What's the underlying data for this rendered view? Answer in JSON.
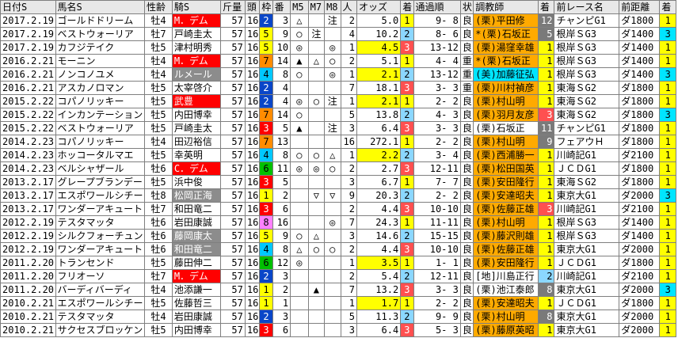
{
  "headers": [
    "日付S",
    "馬名S",
    "性齢",
    "騎S",
    "斤量",
    "頭",
    "枠",
    "番",
    "M5",
    "M7",
    "M8",
    "人",
    "オッズ",
    "着",
    "通過順",
    "状",
    "調教師",
    "着",
    "前レース名",
    "前距離",
    "着"
  ],
  "rows": [
    {
      "date": "2017.2.19",
      "horse": "ゴールドドリーム",
      "age": "牡4",
      "jockey": "M．デム",
      "jk": "red",
      "weight": "57",
      "heads": "16",
      "waku": "2",
      "uma": "3",
      "m5": "△",
      "m7": "",
      "m8": "注",
      "pop": "2",
      "odds": "5.0",
      "oddsHl": false,
      "fin": "1",
      "finC": "fin-1",
      "pass": "9- 8",
      "cond": "良",
      "trainer": "(栗)平田修",
      "trC": "tr-kansai",
      "pfin": "12",
      "pfinC": "fin-other",
      "prace": "チャンピG1",
      "praceC": "",
      "pdist": "ダ1800",
      "pf": "1",
      "pfC": "bar-yellow"
    },
    {
      "date": "2017.2.19",
      "horse": "ベストウォーリア",
      "age": "牡7",
      "jockey": "戸崎圭太",
      "jk": "yellow",
      "weight": "57",
      "heads": "16",
      "waku": "5",
      "uma": "9",
      "m5": "○",
      "m7": "注",
      "m8": "",
      "pop": "4",
      "odds": "10.2",
      "oddsHl": false,
      "fin": "2",
      "finC": "fin-2",
      "pass": "8- 6",
      "cond": "良",
      "trainer": "*(栗)石坂正",
      "trC": "tr-kansai",
      "pfin": "5",
      "pfinC": "fin-other",
      "prace": "根岸ＳG3",
      "praceC": "",
      "pdist": "ダ1400",
      "pf": "3",
      "pfC": "bar-cyan"
    },
    {
      "date": "2017.2.19",
      "horse": "カフジテイク",
      "age": "牡5",
      "jockey": "津村明秀",
      "jk": "yellow",
      "weight": "57",
      "heads": "16",
      "waku": "5",
      "uma": "10",
      "m5": "◎",
      "m7": "",
      "m8": "◎",
      "pop": "1",
      "odds": "4.5",
      "oddsHl": true,
      "fin": "3",
      "finC": "fin-3",
      "pass": "13-12",
      "cond": "良",
      "trainer": "(栗)湯窪幸雄",
      "trC": "tr-kansai",
      "pfin": "1",
      "pfinC": "fin-1",
      "prace": "根岸ＳG3",
      "praceC": "",
      "pdist": "ダ1400",
      "pf": "1",
      "pfC": "bar-yellow"
    },
    {
      "date": "2016.2.21",
      "horse": "モーニン",
      "age": "牡4",
      "jockey": "M．デム",
      "jk": "red",
      "weight": "57",
      "heads": "16",
      "waku": "7",
      "uma": "14",
      "m5": "▲",
      "m7": "△",
      "m8": "○",
      "pop": "2",
      "odds": "5.1",
      "oddsHl": false,
      "fin": "1",
      "finC": "fin-1",
      "pass": "4- 4",
      "cond": "重",
      "trainer": "*(栗)石坂正",
      "trC": "tr-kansai",
      "pfin": "1",
      "pfinC": "fin-1",
      "prace": "根岸ＳG3",
      "praceC": "",
      "pdist": "ダ1400",
      "pf": "1",
      "pfC": "bar-yellow"
    },
    {
      "date": "2016.2.21",
      "horse": "ノンコノユメ",
      "age": "牡4",
      "jockey": "ルメール",
      "jk": "gray",
      "weight": "57",
      "heads": "16",
      "waku": "4",
      "uma": "8",
      "m5": "○",
      "m7": "",
      "m8": "◎",
      "pop": "1",
      "odds": "2.1",
      "oddsHl": true,
      "fin": "2",
      "finC": "fin-2",
      "pass": "13-12",
      "cond": "重",
      "trainer": "(美)加藤征弘",
      "trC": "tr-kanto",
      "pfin": "1",
      "pfinC": "fin-1",
      "prace": "根岸ＳG3",
      "praceC": "",
      "pdist": "ダ1400",
      "pf": "3",
      "pfC": "bar-cyan"
    },
    {
      "date": "2016.2.21",
      "horse": "アスカノロマン",
      "age": "牡5",
      "jockey": "太宰啓介",
      "jk": "yellow",
      "weight": "57",
      "heads": "16",
      "waku": "2",
      "uma": "4",
      "m5": "",
      "m7": "",
      "m8": "",
      "pop": "7",
      "odds": "18.1",
      "oddsHl": false,
      "fin": "3",
      "finC": "fin-3",
      "pass": "3- 3",
      "cond": "重",
      "trainer": "(栗)川村禎彦",
      "trC": "tr-kansai",
      "pfin": "1",
      "pfinC": "fin-1",
      "prace": "東海ＳG2",
      "praceC": "",
      "pdist": "ダ1800",
      "pf": "1",
      "pfC": "bar-yellow"
    },
    {
      "date": "2015.2.22",
      "horse": "コパノリッキー",
      "age": "牡5",
      "jockey": "武豊",
      "jk": "red",
      "weight": "57",
      "heads": "16",
      "waku": "2",
      "uma": "4",
      "m5": "◎",
      "m7": "○",
      "m8": "注",
      "pop": "1",
      "odds": "2.1",
      "oddsHl": true,
      "fin": "1",
      "finC": "fin-1",
      "pass": "2- 2",
      "cond": "良",
      "trainer": "(栗)村山明",
      "trC": "tr-kansai",
      "pfin": "1",
      "pfinC": "fin-1",
      "prace": "東海ＳG2",
      "praceC": "",
      "pdist": "ダ1800",
      "pf": "1",
      "pfC": "bar-yellow"
    },
    {
      "date": "2015.2.22",
      "horse": "インカンテーション",
      "age": "牡5",
      "jockey": "内田博幸",
      "jk": "yellow",
      "weight": "57",
      "heads": "16",
      "waku": "7",
      "uma": "14",
      "m5": "○",
      "m7": "",
      "m8": "",
      "pop": "5",
      "odds": "13.8",
      "oddsHl": false,
      "fin": "2",
      "finC": "fin-2",
      "pass": "4- 3",
      "cond": "良",
      "trainer": "(栗)羽月友彦",
      "trC": "tr-kansai",
      "pfin": "3",
      "pfinC": "fin-3",
      "prace": "東海ＳG2",
      "praceC": "",
      "pdist": "ダ1800",
      "pf": "3",
      "pfC": "bar-cyan"
    },
    {
      "date": "2015.2.22",
      "horse": "ベストウォーリア",
      "age": "牡5",
      "jockey": "戸崎圭太",
      "jk": "yellow",
      "weight": "57",
      "heads": "16",
      "waku": "3",
      "uma": "5",
      "m5": "▲",
      "m7": "",
      "m8": "注",
      "pop": "3",
      "odds": "6.4",
      "oddsHl": false,
      "fin": "3",
      "finC": "fin-3",
      "pass": "3- 3",
      "cond": "良",
      "trainer": "(栗)石坂正",
      "trC": "tr-other",
      "pfin": "11",
      "pfinC": "fin-other",
      "prace": "チャンピG1",
      "praceC": "",
      "pdist": "ダ1800",
      "pf": "1",
      "pfC": "bar-yellow"
    },
    {
      "date": "2014.2.23",
      "horse": "コパノリッキー",
      "age": "牡4",
      "jockey": "田辺裕信",
      "jk": "yellow",
      "weight": "57",
      "heads": "16",
      "waku": "7",
      "uma": "13",
      "m5": "",
      "m7": "",
      "m8": "",
      "pop": "16",
      "odds": "272.1",
      "oddsHl": false,
      "fin": "1",
      "finC": "fin-1",
      "pass": "2- 2",
      "cond": "良",
      "trainer": "(栗)村山明",
      "trC": "tr-kansai",
      "pfin": "9",
      "pfinC": "fin-other",
      "prace": "フェアウＨ",
      "praceC": "",
      "pdist": "ダ1800",
      "pf": "1",
      "pfC": "bar-yellow"
    },
    {
      "date": "2014.2.23",
      "horse": "ホッコータルマエ",
      "age": "牡5",
      "jockey": "幸英明",
      "jk": "yellow",
      "weight": "57",
      "heads": "16",
      "waku": "4",
      "uma": "8",
      "m5": "○",
      "m7": "○",
      "m8": "△",
      "pop": "1",
      "odds": "2.2",
      "oddsHl": true,
      "fin": "2",
      "finC": "fin-2",
      "pass": "3- 4",
      "cond": "良",
      "trainer": "(栗)西浦勝一",
      "trC": "tr-kansai",
      "pfin": "1",
      "pfinC": "fin-1",
      "prace": "川崎記G1",
      "praceC": "",
      "pdist": "ダ2100",
      "pf": "1",
      "pfC": "bar-yellow"
    },
    {
      "date": "2014.2.23",
      "horse": "ベルシャザール",
      "age": "牡6",
      "jockey": "C．デム",
      "jk": "red",
      "weight": "57",
      "heads": "16",
      "waku": "6",
      "uma": "11",
      "m5": "◎",
      "m7": "◎",
      "m8": "○",
      "pop": "2",
      "odds": "2.7",
      "oddsHl": false,
      "fin": "3",
      "finC": "fin-3",
      "pass": "12-11",
      "cond": "良",
      "trainer": "(栗)松田国英",
      "trC": "tr-kansai",
      "pfin": "1",
      "pfinC": "fin-1",
      "prace": "ＪＣＤG1",
      "praceC": "",
      "pdist": "ダ1800",
      "pf": "1",
      "pfC": "bar-yellow"
    },
    {
      "date": "2013.2.17",
      "horse": "グレープブランデー",
      "age": "牡5",
      "jockey": "浜中俊",
      "jk": "yellow",
      "weight": "57",
      "heads": "16",
      "waku": "3",
      "uma": "5",
      "m5": "",
      "m7": "",
      "m8": "",
      "pop": "3",
      "odds": "6.7",
      "oddsHl": false,
      "fin": "1",
      "finC": "fin-1",
      "pass": "7- 7",
      "cond": "良",
      "trainer": "(栗)安田隆行",
      "trC": "tr-kansai",
      "pfin": "1",
      "pfinC": "fin-1",
      "prace": "東海ＳG2",
      "praceC": "",
      "pdist": "ダ1800",
      "pf": "1",
      "pfC": "bar-yellow"
    },
    {
      "date": "2013.2.17",
      "horse": "エスポワールシチー",
      "age": "牡8",
      "jockey": "松岡正海",
      "jk": "gray",
      "weight": "57",
      "heads": "16",
      "waku": "1",
      "uma": "2",
      "m5": "",
      "m7": "▽",
      "m8": "▽",
      "pop": "9",
      "odds": "20.3",
      "oddsHl": false,
      "fin": "2",
      "finC": "fin-2",
      "pass": "2- 2",
      "cond": "良",
      "trainer": "(栗)安達昭夫",
      "trC": "tr-kansai",
      "pfin": "1",
      "pfinC": "fin-1",
      "prace": "東京大G1",
      "praceC": "",
      "pdist": "ダ2000",
      "pf": "3",
      "pfC": "bar-cyan"
    },
    {
      "date": "2013.2.17",
      "horse": "ワンダーアキュート",
      "age": "牡7",
      "jockey": "和田竜二",
      "jk": "yellow",
      "weight": "57",
      "heads": "16",
      "waku": "3",
      "uma": "6",
      "m5": "",
      "m7": "",
      "m8": "",
      "pop": "2",
      "odds": "4.4",
      "oddsHl": false,
      "fin": "3",
      "finC": "fin-3",
      "pass": "10-10",
      "cond": "良",
      "trainer": "(栗)佐藤正雄",
      "trC": "tr-kansai",
      "pfin": "3",
      "pfinC": "fin-3",
      "prace": "川崎記G1",
      "praceC": "",
      "pdist": "ダ2100",
      "pf": "1",
      "pfC": "bar-yellow"
    },
    {
      "date": "2012.2.19",
      "horse": "テスタマッタ",
      "age": "牡6",
      "jockey": "岩田康誠",
      "jk": "yellow",
      "weight": "57",
      "heads": "16",
      "waku": "8",
      "uma": "16",
      "m5": "",
      "m7": "",
      "m8": "◎",
      "pop": "7",
      "odds": "24.3",
      "oddsHl": false,
      "fin": "1",
      "finC": "fin-1",
      "pass": "11-11",
      "cond": "良",
      "trainer": "(栗)村山明",
      "trC": "tr-kansai",
      "pfin": "1",
      "pfinC": "fin-1",
      "prace": "根岸ＳG3",
      "praceC": "",
      "pdist": "ダ1400",
      "pf": "1",
      "pfC": "bar-yellow"
    },
    {
      "date": "2012.2.19",
      "horse": "シルクフォーチュン",
      "age": "牡6",
      "jockey": "藤岡康太",
      "jk": "gray",
      "weight": "57",
      "heads": "16",
      "waku": "5",
      "uma": "9",
      "m5": "○",
      "m7": "△",
      "m8": "",
      "pop": "3",
      "odds": "14.6",
      "oddsHl": false,
      "fin": "2",
      "finC": "fin-2",
      "pass": "15-15",
      "cond": "良",
      "trainer": "(栗)藤沢則雄",
      "trC": "tr-kansai",
      "pfin": "1",
      "pfinC": "fin-1",
      "prace": "根岸ＳG3",
      "praceC": "",
      "pdist": "ダ1400",
      "pf": "1",
      "pfC": "bar-yellow"
    },
    {
      "date": "2012.2.19",
      "horse": "ワンダーアキュート",
      "age": "牡6",
      "jockey": "和田竜二",
      "jk": "gray",
      "weight": "57",
      "heads": "16",
      "waku": "4",
      "uma": "8",
      "m5": "△",
      "m7": "○",
      "m8": "○",
      "pop": "2",
      "odds": "4.4",
      "oddsHl": false,
      "fin": "3",
      "finC": "fin-3",
      "pass": "10-10",
      "cond": "良",
      "trainer": "(栗)佐藤正雄",
      "trC": "tr-kansai",
      "pfin": "1",
      "pfinC": "fin-1",
      "prace": "東京大G1",
      "praceC": "",
      "pdist": "ダ2000",
      "pf": "1",
      "pfC": "bar-yellow"
    },
    {
      "date": "2011.2.20",
      "horse": "トランセンド",
      "age": "牡5",
      "jockey": "藤田伸二",
      "jk": "yellow",
      "weight": "57",
      "heads": "16",
      "waku": "6",
      "uma": "12",
      "m5": "◎",
      "m7": "",
      "m8": "",
      "pop": "1",
      "odds": "3.5",
      "oddsHl": true,
      "fin": "1",
      "finC": "fin-1",
      "pass": "1- 1",
      "cond": "良",
      "trainer": "(栗)安田隆行",
      "trC": "tr-kansai",
      "pfin": "1",
      "pfinC": "fin-1",
      "prace": "ＪＣＤG1",
      "praceC": "",
      "pdist": "ダ1800",
      "pf": "1",
      "pfC": "bar-yellow"
    },
    {
      "date": "2011.2.20",
      "horse": "フリオーソ",
      "age": "牡7",
      "jockey": "M．デム",
      "jk": "red",
      "weight": "57",
      "heads": "16",
      "waku": "2",
      "uma": "3",
      "m5": "",
      "m7": "",
      "m8": "",
      "pop": "2",
      "odds": "5.4",
      "oddsHl": false,
      "fin": "2",
      "finC": "fin-2",
      "pass": "12-11",
      "cond": "良",
      "trainer": "[地]川島正行",
      "trC": "tr-other",
      "pfin": "2",
      "pfinC": "fin-2",
      "prace": "川崎記G1",
      "praceC": "",
      "pdist": "ダ2100",
      "pf": "1",
      "pfC": "bar-yellow"
    },
    {
      "date": "2011.2.20",
      "horse": "バーディバーディ",
      "age": "牡4",
      "jockey": "池添謙一",
      "jk": "yellow",
      "weight": "57",
      "heads": "16",
      "waku": "1",
      "uma": "2",
      "m5": "",
      "m7": "▲",
      "m8": "",
      "pop": "7",
      "odds": "13.2",
      "oddsHl": false,
      "fin": "3",
      "finC": "fin-3",
      "pass": "3- 3",
      "cond": "良",
      "trainer": "(栗)池江泰郎",
      "trC": "tr-other",
      "pfin": "8",
      "pfinC": "fin-other",
      "prace": "東京大G1",
      "praceC": "",
      "pdist": "ダ2000",
      "pf": "3",
      "pfC": "bar-cyan"
    },
    {
      "date": "2010.2.21",
      "horse": "エスポワールシチー",
      "age": "牡5",
      "jockey": "佐藤哲三",
      "jk": "none",
      "weight": "57",
      "heads": "16",
      "waku": "1",
      "uma": "1",
      "m5": "",
      "m7": "",
      "m8": "",
      "pop": "1",
      "odds": "1.7",
      "oddsHl": true,
      "fin": "1",
      "finC": "fin-1",
      "pass": "2- 2",
      "cond": "良",
      "trainer": "(栗)安達昭夫",
      "trC": "tr-kansai",
      "pfin": "1",
      "pfinC": "fin-1",
      "prace": "ＪＣＤG1",
      "praceC": "",
      "pdist": "ダ1800",
      "pf": "1",
      "pfC": "bar-yellow"
    },
    {
      "date": "2010.2.21",
      "horse": "テスタマッタ",
      "age": "牡4",
      "jockey": "岩田康誠",
      "jk": "yellow",
      "weight": "57",
      "heads": "16",
      "waku": "2",
      "uma": "3",
      "m5": "",
      "m7": "",
      "m8": "",
      "pop": "5",
      "odds": "11.3",
      "oddsHl": false,
      "fin": "2",
      "finC": "fin-2",
      "pass": "9- 9",
      "cond": "良",
      "trainer": "(栗)村山明",
      "trC": "tr-kansai",
      "pfin": "8",
      "pfinC": "fin-other",
      "prace": "東京大G1",
      "praceC": "",
      "pdist": "ダ2000",
      "pf": "1",
      "pfC": "bar-yellow"
    },
    {
      "date": "2010.2.21",
      "horse": "サクセスブロッケン",
      "age": "牡5",
      "jockey": "内田博幸",
      "jk": "yellow",
      "weight": "57",
      "heads": "16",
      "waku": "3",
      "uma": "6",
      "m5": "",
      "m7": "",
      "m8": "",
      "pop": "3",
      "odds": "6.4",
      "oddsHl": false,
      "fin": "3",
      "finC": "fin-3",
      "pass": "5- 3",
      "cond": "良",
      "trainer": "(栗)藤原英昭",
      "trC": "tr-kansai",
      "pfin": "1",
      "pfinC": "fin-1",
      "prace": "東京大G1",
      "praceC": "",
      "pdist": "ダ2000",
      "pf": "1",
      "pfC": "bar-yellow"
    }
  ]
}
